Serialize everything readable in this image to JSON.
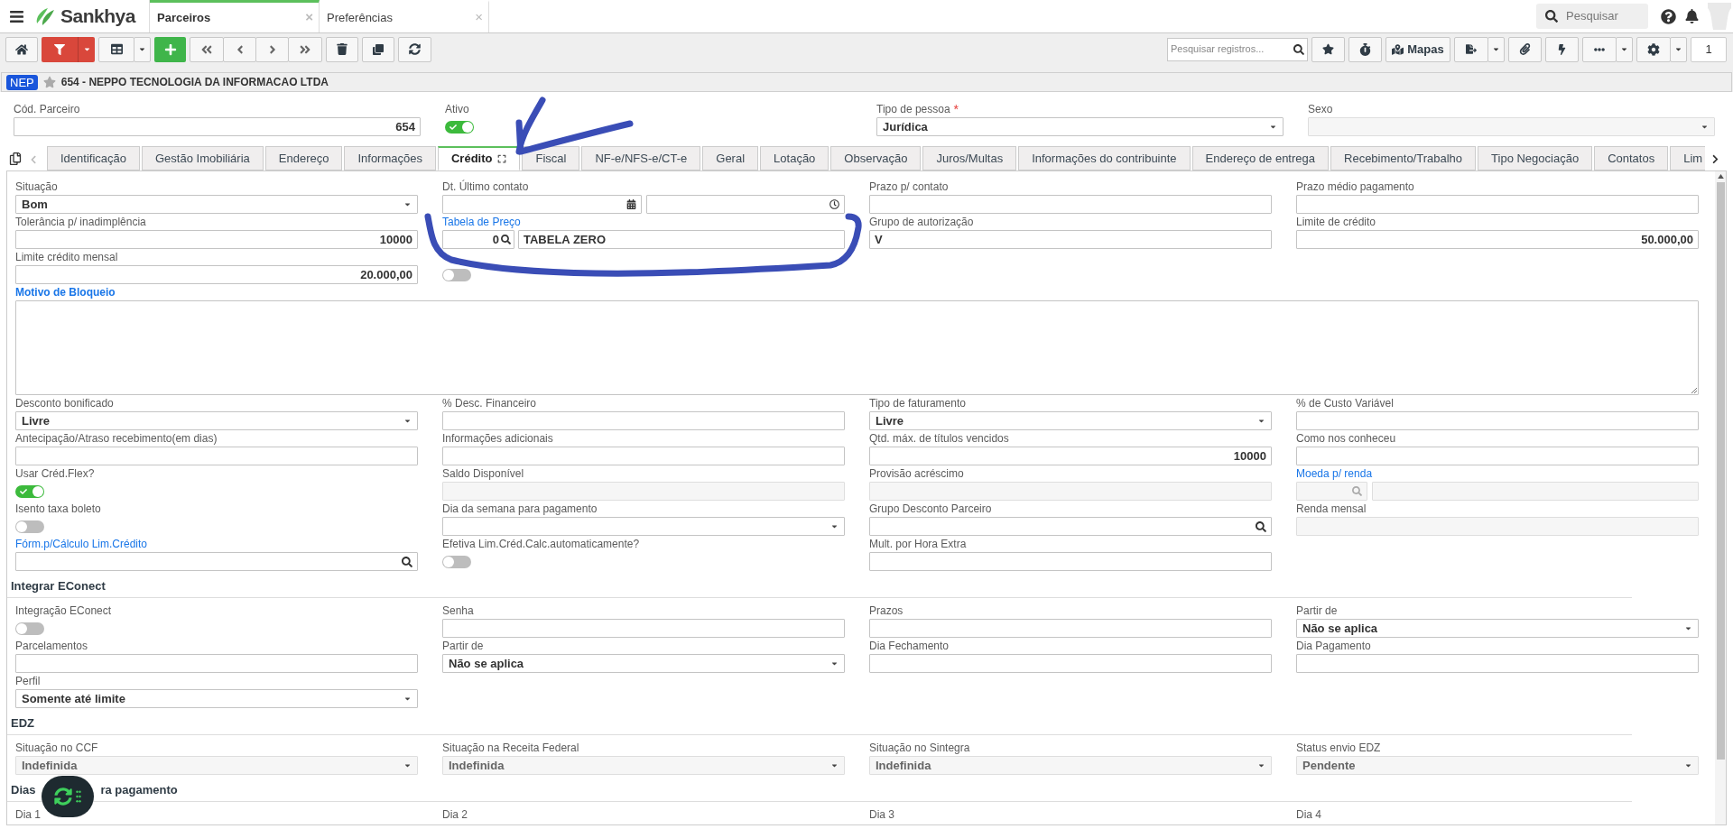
{
  "header": {
    "logo": "Sankhya",
    "tabs": [
      {
        "label": "Parceiros",
        "selected": true,
        "close": "×"
      },
      {
        "label": "Preferências",
        "selected": false,
        "close": "×"
      }
    ],
    "search": {
      "placeholder": "Pesquisar"
    }
  },
  "toolbar": {
    "filter_active": true,
    "search": {
      "placeholder": "Pesquisar registros..."
    },
    "maps_label": "Mapas",
    "page": "1"
  },
  "record": {
    "badge": "NEP",
    "title": "654 - NEPPO TECNOLOGIA DA INFORMACAO LTDA"
  },
  "header_fields": [
    {
      "kind": "number",
      "label": "Cód. Parceiro",
      "value": "654"
    },
    {
      "kind": "toggle",
      "label": "Ativo",
      "on": true
    },
    {
      "kind": "select",
      "label": "Tipo de pessoa",
      "required_mark": "*",
      "value": "Jurídica"
    },
    {
      "kind": "select",
      "label": "Sexo",
      "disabled": true
    }
  ],
  "tabs": [
    {
      "label": "Identificação",
      "selected": false
    },
    {
      "label": "Gestão Imobiliária",
      "selected": false
    },
    {
      "label": "Endereço",
      "selected": false
    },
    {
      "label": "Informações",
      "selected": false
    },
    {
      "label": "Crédito",
      "selected": true
    },
    {
      "label": "Fiscal",
      "selected": false
    },
    {
      "label": "NF-e/NFS-e/CT-e",
      "selected": false
    },
    {
      "label": "Geral",
      "selected": false
    },
    {
      "label": "Lotação",
      "selected": false
    },
    {
      "label": "Observação",
      "selected": false
    },
    {
      "label": "Juros/Multas",
      "selected": false
    },
    {
      "label": "Informações do contribuinte",
      "selected": false
    },
    {
      "label": "Endereço de entrega",
      "selected": false
    },
    {
      "label": "Recebimento/Trabalho",
      "selected": false
    },
    {
      "label": "Tipo Negociação",
      "selected": false
    },
    {
      "label": "Contatos",
      "selected": false
    },
    {
      "label": "Lim",
      "selected": false
    }
  ],
  "sections": [
    {
      "rows": [
        [
          {
            "kind": "select",
            "label": "Situação",
            "value": "Bom"
          },
          {
            "kind": "date",
            "label": "Dt. Último contato"
          },
          {
            "kind": "text",
            "label": "Prazo p/ contato"
          },
          {
            "kind": "text",
            "label": "Prazo médio pagamento"
          }
        ],
        [
          {
            "kind": "number",
            "label": "Tolerância p/ inadimplência",
            "value": "10000"
          },
          {
            "kind": "price",
            "label": "Tabela de Preço",
            "linked": true,
            "code": "0",
            "name": "TABELA ZERO"
          },
          {
            "kind": "text",
            "label": "Grupo de autorização",
            "value": "V"
          },
          {
            "kind": "number",
            "label": "Limite de crédito",
            "value": "50.000,00"
          }
        ],
        [
          {
            "kind": "number",
            "label": "Limite crédito mensal",
            "value": "20.000,00"
          },
          {
            "kind": "toggle",
            "on": false
          },
          null,
          null
        ],
        [
          {
            "kind": "textarea",
            "label": "Motivo de Bloqueio",
            "linked": true
          }
        ],
        [
          {
            "kind": "select",
            "label": "Desconto bonificado",
            "value": "Livre"
          },
          {
            "kind": "text",
            "label": "% Desc. Financeiro"
          },
          {
            "kind": "select",
            "label": "Tipo de faturamento",
            "value": "Livre"
          },
          {
            "kind": "text",
            "label": "% de Custo Variável"
          }
        ],
        [
          {
            "kind": "text",
            "label": "Antecipação/Atraso recebimento(em dias)"
          },
          {
            "kind": "text",
            "label": "Informações adicionais"
          },
          {
            "kind": "number",
            "label": "Qtd. máx. de títulos vencidos",
            "value": "10000"
          },
          {
            "kind": "text",
            "label": "Como nos conheceu"
          }
        ],
        [
          {
            "kind": "toggle",
            "label": "Usar Créd.Flex?",
            "on": true
          },
          {
            "kind": "text",
            "label": "Saldo Disponível",
            "disabled": true
          },
          {
            "kind": "text",
            "label": "Provisão acréscimo",
            "disabled": true
          },
          {
            "kind": "currency",
            "label": "Moeda p/ renda",
            "linked": true,
            "disabled": true
          }
        ],
        [
          {
            "kind": "toggle",
            "label": "Isento taxa boleto",
            "on": false
          },
          {
            "kind": "select",
            "label": "Dia da semana para pagamento"
          },
          {
            "kind": "lookup",
            "label": "Grupo Desconto Parceiro"
          },
          {
            "kind": "text",
            "label": "Renda mensal",
            "disabled": true
          }
        ],
        [
          {
            "kind": "lookup",
            "label": "Fórm.p/Cálculo Lim.Crédito",
            "linked": true
          },
          {
            "kind": "toggle",
            "label": "Efetiva Lim.Créd.Calc.automaticamente?",
            "on": false
          },
          {
            "kind": "text",
            "label": "Mult. por Hora Extra"
          },
          null
        ]
      ]
    },
    {
      "title_parts": [
        "Integrar EConect"
      ],
      "rows": [
        [
          {
            "kind": "toggle",
            "label": "Integração EConect",
            "on": false
          },
          {
            "kind": "text",
            "label": "Senha"
          },
          {
            "kind": "text",
            "label": "Prazos"
          },
          {
            "kind": "select",
            "label": "Partir de",
            "value": "Não se aplica"
          }
        ],
        [
          {
            "kind": "text",
            "label": "Parcelamentos"
          },
          {
            "kind": "select",
            "label": "Partir de",
            "value": "Não se aplica"
          },
          {
            "kind": "text",
            "label": "Dia Fechamento"
          },
          {
            "kind": "text",
            "label": "Dia Pagamento"
          }
        ],
        [
          {
            "kind": "select",
            "label": "Perfil",
            "value": "Somente até limite"
          },
          null,
          null,
          null
        ]
      ]
    },
    {
      "title_parts": [
        "EDZ"
      ],
      "rows": [
        [
          {
            "kind": "select",
            "label": "Situação no CCF",
            "value": "Indefinida",
            "disabled": true
          },
          {
            "kind": "select",
            "label": "Situação na Receita Federal",
            "value": "Indefinida",
            "disabled": true
          },
          {
            "kind": "select",
            "label": "Situação no Sintegra",
            "value": "Indefinida",
            "disabled": true
          },
          {
            "kind": "select",
            "label": "Status envio EDZ",
            "value": "Pendente",
            "disabled": true
          }
        ]
      ]
    },
    {
      "title_parts": [
        "Dias",
        "ra pagamento"
      ],
      "rows": [
        [
          {
            "kind": "caption",
            "label": "Dia 1"
          },
          {
            "kind": "caption",
            "label": "Dia 2"
          },
          {
            "kind": "caption",
            "label": "Dia 3"
          },
          {
            "kind": "caption",
            "label": "Dia 4"
          }
        ]
      ]
    }
  ]
}
